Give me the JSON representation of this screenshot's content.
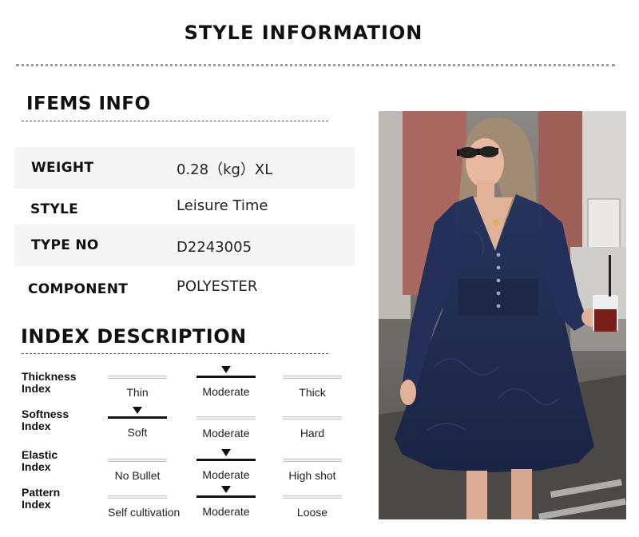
{
  "title": "STYLE INFORMATION",
  "items_info": {
    "heading": "IFEMS INFO",
    "rows": [
      {
        "label": "WEIGHT",
        "value": "0.28（kg）XL"
      },
      {
        "label": "STYLE",
        "value": "Leisure Time"
      },
      {
        "label": "TYPE NO",
        "value": "D2243005"
      },
      {
        "label": "COMPONENT",
        "value": "POLYESTER"
      }
    ]
  },
  "index_description": {
    "heading": "INDEX DESCRIPTION",
    "rows": [
      {
        "label_line1": "Thickness",
        "label_line2": "Index",
        "options": [
          "Thin",
          "Moderate",
          "Thick"
        ],
        "selected_index": 1
      },
      {
        "label_line1": "Softness",
        "label_line2": "Index",
        "options": [
          "Soft",
          "Moderate",
          "Hard"
        ],
        "selected_index": 0
      },
      {
        "label_line1": "Elastic",
        "label_line2": "Index",
        "options": [
          "No Bullet",
          "Moderate",
          "High shot"
        ],
        "selected_index": 1
      },
      {
        "label_line1": "Pattern",
        "label_line2": "Index",
        "options": [
          "Self cultivation",
          "Moderate",
          "Loose"
        ],
        "selected_index": 1
      }
    ]
  },
  "colors": {
    "dress": "#1f2a4d",
    "marker": "#111111",
    "row_shade": "#f5f5f5"
  }
}
